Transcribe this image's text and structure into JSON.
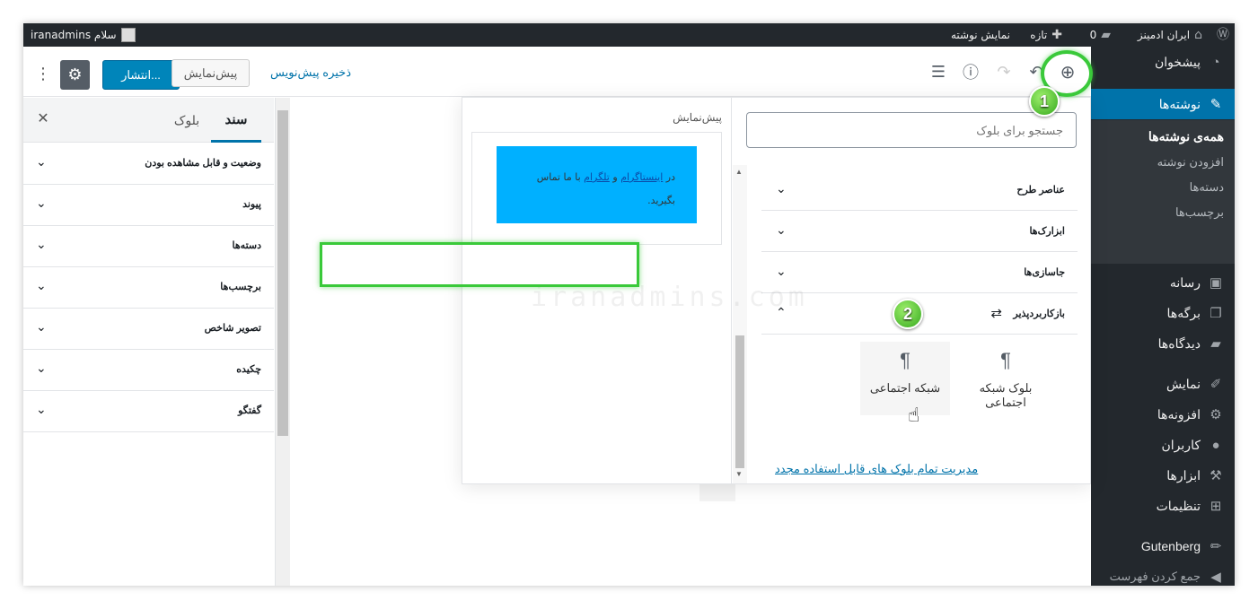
{
  "adminbar": {
    "site_name": "ایران ادمینز",
    "comments_count": "0",
    "new_label": "تازه",
    "view_post": "نمایش نوشته",
    "greeting": "سلام iranadmins"
  },
  "sidebar": {
    "items": [
      {
        "label": "پیشخوان",
        "icon": "dashboard-icon"
      },
      {
        "label": "نوشته‌ها",
        "icon": "pin-icon"
      },
      {
        "label": "رسانه",
        "icon": "media-icon"
      },
      {
        "label": "برگه‌ها",
        "icon": "page-icon"
      },
      {
        "label": "دیدگاه‌ها",
        "icon": "comment-icon"
      },
      {
        "label": "نمایش",
        "icon": "brush-icon"
      },
      {
        "label": "افزونه‌ها",
        "icon": "plugin-icon"
      },
      {
        "label": "کاربران",
        "icon": "user-icon"
      },
      {
        "label": "ابزارها",
        "icon": "wrench-icon"
      },
      {
        "label": "تنظیمات",
        "icon": "settings-icon"
      },
      {
        "label": "Gutenberg",
        "icon": "pencil-icon"
      },
      {
        "label": "جمع کردن فهرست",
        "icon": "collapse-icon"
      }
    ],
    "submenu": [
      "همه‌ی نوشته‌ها",
      "افزودن نوشته",
      "دسته‌ها",
      "برچسب‌ها"
    ]
  },
  "toolbar": {
    "save_draft": "ذخیره پیش‌نویس",
    "preview": "پیش‌نمایش",
    "publish": "انتشار..."
  },
  "docpanel": {
    "tab_document": "سند",
    "tab_block": "بلوک",
    "rows": [
      "وضعیت و قابل مشاهده بودن",
      "پیوند",
      "دسته‌ها",
      "برچسب‌ها",
      "تصویر شاخص",
      "چکیده",
      "گفتگو"
    ]
  },
  "inserter": {
    "preview_title": "پیش‌نمایش",
    "preview_text_1": "در ",
    "preview_link_1": "اینستاگرام",
    "preview_text_2": " و ",
    "preview_link_2": "تلگرام",
    "preview_text_3": " با ما تماس بگیرید.",
    "search_placeholder": "جستجو برای بلوک",
    "categories": [
      "عناصر طرح",
      "ابزارک‌ها",
      "جاسازی‌ها",
      "بازکاربردپذیر"
    ],
    "blocks": [
      "بلوک شبکه اجتماعی",
      "شبکه اجتماعی"
    ],
    "manage_link": "مدیریت تمام بلوک های قابل استفاده مجدد"
  },
  "annotations": {
    "one": "1",
    "two": "2"
  },
  "watermark": "iranadmins.com",
  "colors": {
    "accent": "#0073aa",
    "highlight": "#3ac93a",
    "preview_bg": "#00b0ff",
    "sidebar_bg": "#23282d"
  }
}
